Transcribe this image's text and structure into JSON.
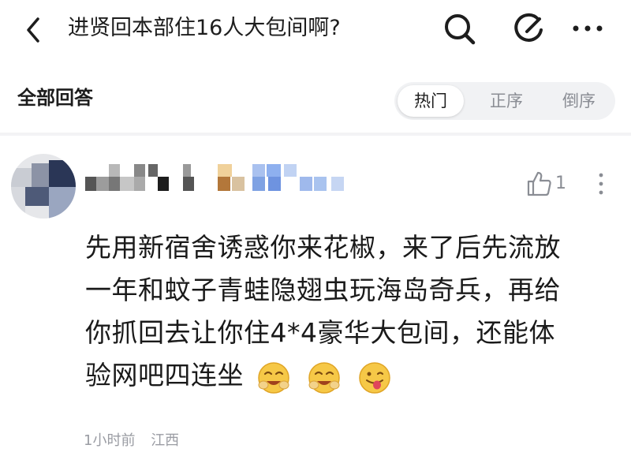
{
  "header": {
    "title": "进贤回本部住16人大包间啊?",
    "back_icon": "chevron-left-icon",
    "search_icon": "search-icon",
    "compose_icon": "compose-icon",
    "more_icon": "more-icon"
  },
  "answers_section": {
    "title": "全部回答",
    "sort_options": [
      "热门",
      "正序",
      "倒序"
    ],
    "selected_sort": "热门"
  },
  "answer": {
    "author_name": "",
    "author_name_blurred": true,
    "like_count": "1",
    "content_lines": [
      "先用新宿舍诱惑你来花椒，来了后先流放",
      "一年和蚊子青蛙隐翅虫玩海岛奇兵，再给",
      "你抓回去让你住4*4豪华大包间，还能体",
      "验网吧四连坐"
    ],
    "emojis": [
      "laughing-face-emoji",
      "laughing-face-emoji",
      "tongue-out-face-emoji"
    ],
    "time": "1小时前",
    "location": "江西"
  }
}
